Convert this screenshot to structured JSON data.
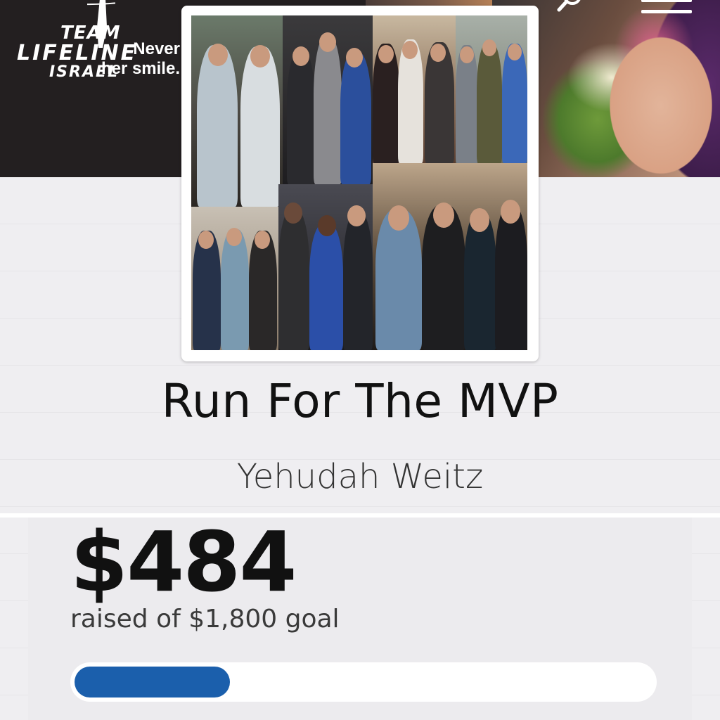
{
  "header": {
    "logo": {
      "line1": "TEAM",
      "line2": "LIFELINE",
      "line3": "ISRAEL"
    },
    "tagline": {
      "line1": "Never",
      "line2": "her smile."
    },
    "menu_icon": "hamburger-menu-icon",
    "search_icon": "search-icon"
  },
  "campaign": {
    "title": "Run For The MVP",
    "owner": "Yehudah Weitz"
  },
  "fundraising": {
    "raised": "$484",
    "caption": "raised of $1,800 goal",
    "progress_fraction": 0.269
  },
  "colors": {
    "progress": "#1b5fac",
    "banner_bg": "#231f20"
  }
}
